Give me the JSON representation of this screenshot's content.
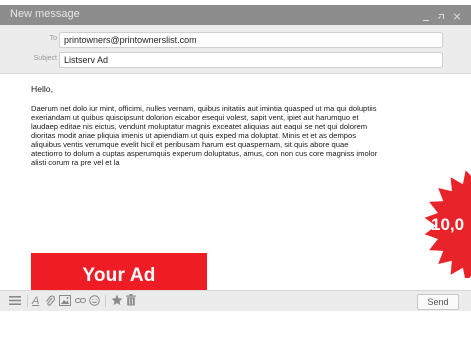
{
  "window": {
    "title": "New message"
  },
  "fields": {
    "to_label": "To",
    "to_value": "printowners@printownerslist.com",
    "subject_label": "Subject",
    "subject_value": "Listserv Ad"
  },
  "message": {
    "greeting": "Hello,",
    "body": "Daerum net dolo iur mint, officimi, nulles vernam, quibus initatiis aut imintia quasped ut ma qui doluptiis exeriandam ut quibus quiscipsunt dolorion eicabor esequi volest, sapit vent, ipiet aut harumquo et laudaep editae nis eictus, vendunt moluptatur magnis exceatet aliquias aut eaqui se net qui dolorem dioritas modit ariae pliquia imenis ut apiendiam ut quis exped ma doluptat. Minis et et as dempos aliquibus ventis verumque evelit hicil et peribusam harum est quaspernam, sit quis abore quae atectiorro to dolum a cuptas asperumquis experum doluptatus, amus, con non cus core magniss imolor alisti corum ra pre vel et la"
  },
  "ad": {
    "label": "Your Ad",
    "color": "#ee1c25"
  },
  "badge": {
    "text": "10,0",
    "color": "#e8232a"
  },
  "toolbar": {
    "icons": [
      "menu-icon",
      "text-format-icon",
      "attachment-icon",
      "image-icon",
      "link-icon",
      "emoji-icon",
      "star-icon",
      "trash-icon"
    ],
    "send_label": "Send"
  }
}
